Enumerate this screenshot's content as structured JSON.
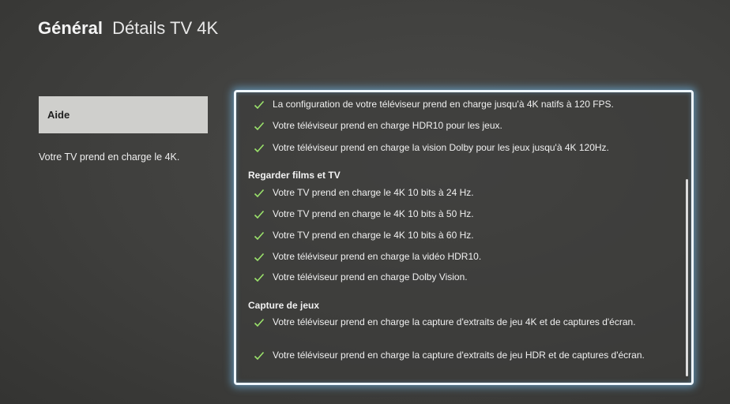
{
  "header": {
    "section": "Général",
    "page_title": "Détails TV 4K"
  },
  "sidebar": {
    "help_label": "Aide",
    "description": "Votre TV prend en charge le 4K."
  },
  "panel": {
    "check_color": "#9be36b",
    "accent_glow": "#78c8ff",
    "top_items": [
      "La configuration de votre téléviseur prend en charge jusqu'à 4K natifs à 120 FPS.",
      "Votre téléviseur prend en charge HDR10 pour les jeux.",
      "Votre téléviseur prend en charge la vision Dolby pour les jeux jusqu'à 4K 120Hz."
    ],
    "groups": [
      {
        "title": "Regarder films et TV",
        "items": [
          "Votre TV prend en charge le 4K 10 bits à 24 Hz.",
          "Votre TV prend en charge le 4K 10 bits à 50 Hz.",
          "Votre TV prend en charge le 4K 10 bits à 60 Hz.",
          "Votre téléviseur prend en charge la vidéo HDR10.",
          "Votre téléviseur prend en charge Dolby Vision."
        ]
      },
      {
        "title": "Capture de jeux",
        "items": [
          "Votre téléviseur prend en charge la capture d'extraits de jeu 4K et de captures d'écran.",
          "Votre téléviseur prend en charge la capture d'extraits de jeu HDR et de captures d'écran."
        ]
      }
    ]
  }
}
